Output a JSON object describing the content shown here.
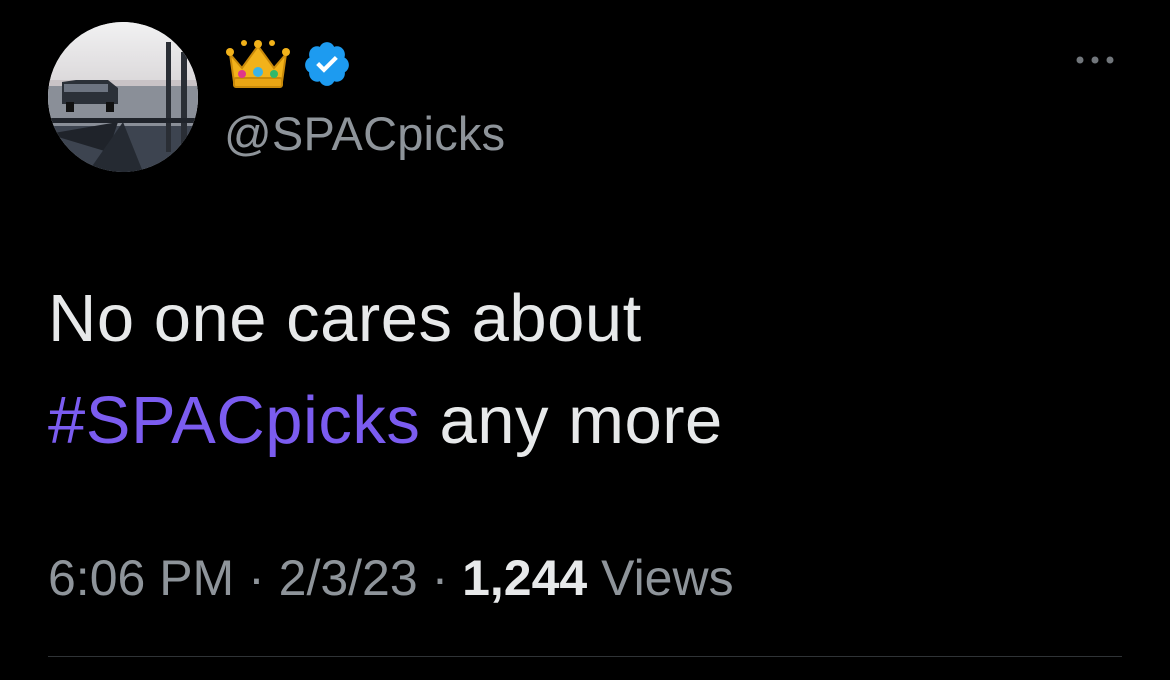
{
  "author": {
    "display_name_emoji": "crown-emoji",
    "verified": true,
    "handle": "@SPACpicks",
    "verified_color": "#1d9bf0"
  },
  "tweet": {
    "text_line1": "No one cares about",
    "hashtag": "#SPACpicks",
    "text_after_hashtag": " any more",
    "hashtag_color": "#7b5cf0"
  },
  "meta": {
    "time": "6:06 PM",
    "sep1": " · ",
    "date": "2/3/23",
    "sep2": " · ",
    "views_count": "1,244",
    "views_label": " Views"
  },
  "icons": {
    "more": "more-horizontal-icon",
    "verified": "verified-badge-icon",
    "crown": "crown-icon"
  }
}
